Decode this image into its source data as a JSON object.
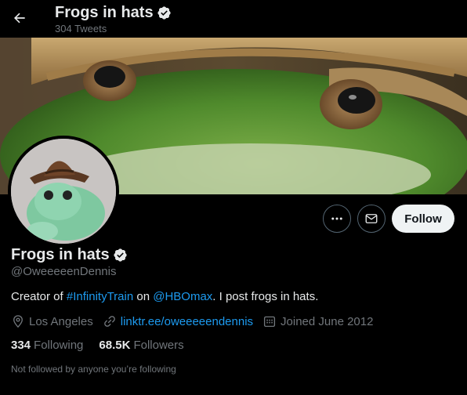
{
  "header": {
    "back_icon": "arrow-left-icon",
    "title": "Frogs in hats",
    "tweet_count": "304 Tweets",
    "verified_icon": "verified-badge-icon"
  },
  "banner": {
    "description": "banner-photo"
  },
  "profile": {
    "name": "Frogs in hats",
    "handle": "@OweeeeenDennis",
    "bio": {
      "part1": "Creator of ",
      "hashtag": "#InfinityTrain",
      "part2": " on ",
      "mention": "@HBOmax",
      "part3": ". I post frogs in hats."
    },
    "location": "Los Angeles",
    "url": "linktr.ee/oweeeeendennis",
    "joined": "Joined June 2012",
    "following_count": "334",
    "following_label": "Following",
    "followers_count": "68.5K",
    "followers_label": "Followers",
    "not_followed_text": "Not followed by anyone you’re following"
  },
  "actions": {
    "more_icon": "ellipsis-icon",
    "message_icon": "envelope-icon",
    "follow_label": "Follow"
  },
  "colors": {
    "background": "#000000",
    "text_primary": "#e7e9ea",
    "text_secondary": "#71767b",
    "link": "#1d9bf0",
    "button_border": "#536471",
    "follow_bg": "#eff3f4"
  }
}
